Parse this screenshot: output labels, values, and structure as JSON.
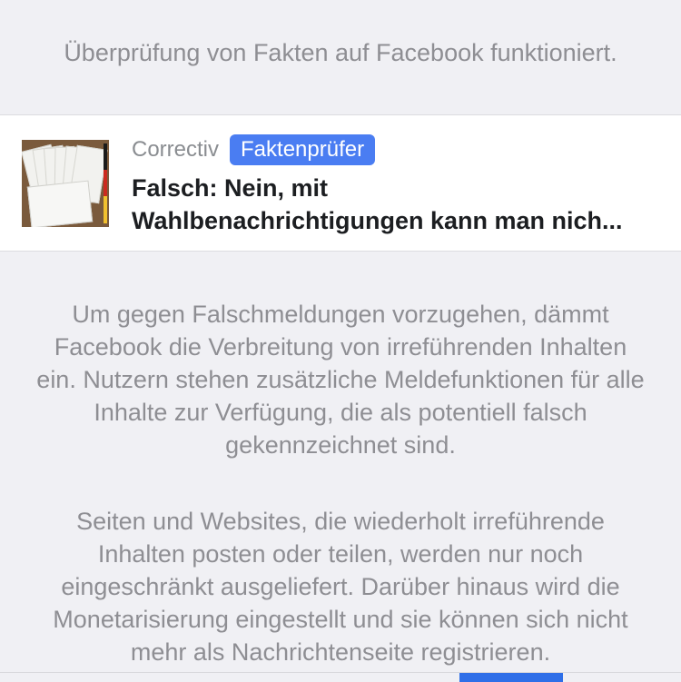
{
  "intro": {
    "text": "Überprüfung von Fakten auf Facebook funktioniert."
  },
  "article": {
    "source": "Correctiv",
    "badge": "Faktenprüfer",
    "headline_line1": "Falsch: Nein, mit",
    "headline_line2": "Wahlbenachrichtigungen kann man nich..."
  },
  "info": {
    "paragraph1": "Um gegen Falschmeldungen vorzugehen, dämmt Facebook die Verbreitung von irreführenden Inhalten ein. Nutzern stehen zusätzliche Meldefunktionen für alle Inhalte zur Verfügung, die als potentiell falsch gekennzeichnet sind.",
    "paragraph2": "Seiten und Websites, die wiederholt irreführende Inhalten posten oder teilen, werden nur noch eingeschränkt ausgeliefert. Darüber hinaus wird die Monetarisierung eingestellt und sie können sich nicht mehr als Nachrichtenseite registrieren."
  },
  "colors": {
    "background": "#f0f0f4",
    "badge": "#4a7df2",
    "muted_text": "#8e8e93",
    "headline_text": "#1c1e21"
  }
}
